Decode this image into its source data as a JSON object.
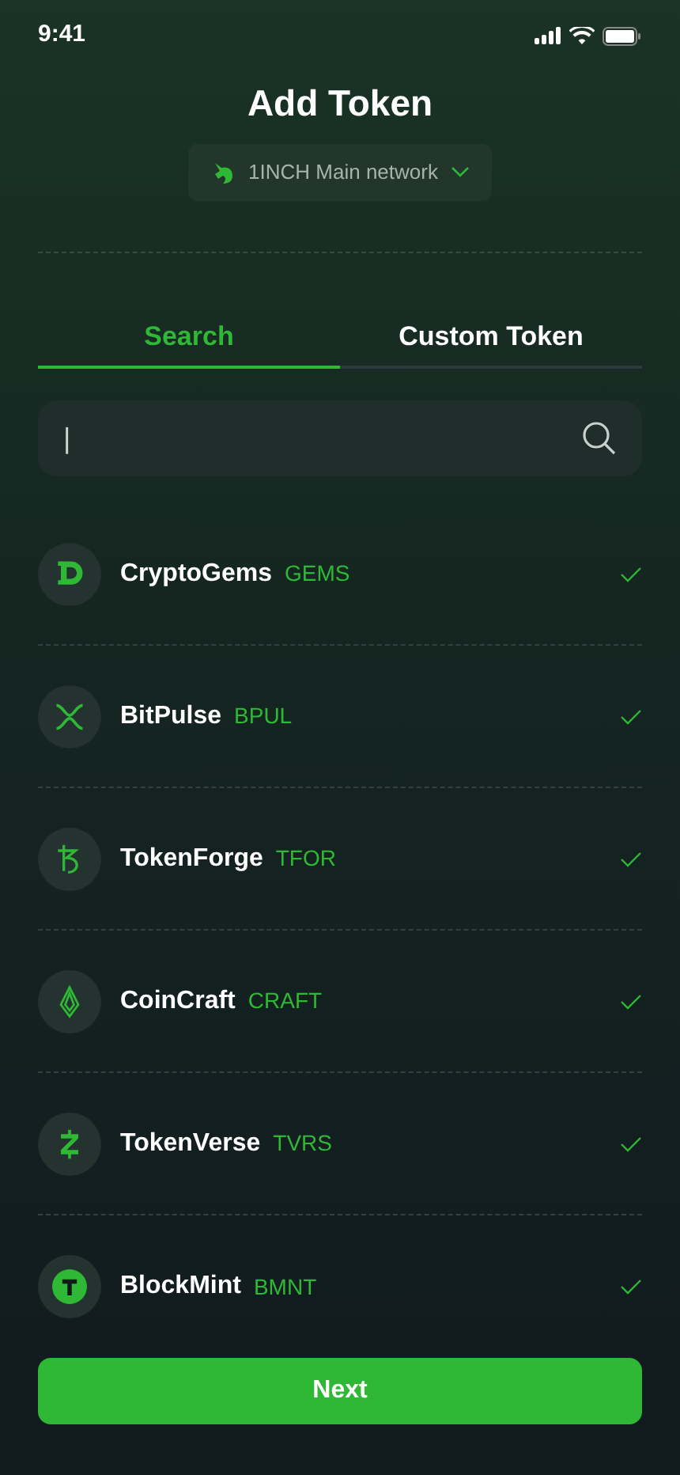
{
  "status_bar": {
    "time": "9:41"
  },
  "title": "Add Token",
  "network": {
    "label": "1INCH Main network"
  },
  "tabs": [
    {
      "label": "Search",
      "selected": true
    },
    {
      "label": "Custom Token",
      "selected": false
    }
  ],
  "search": {
    "value": "|"
  },
  "tokens": [
    {
      "name": "CryptoGems",
      "symbol": "GEMS",
      "checked": true
    },
    {
      "name": "BitPulse",
      "symbol": "BPUL",
      "checked": true
    },
    {
      "name": "TokenForge",
      "symbol": "TFOR",
      "checked": true
    },
    {
      "name": "CoinCraft",
      "symbol": "CRAFT",
      "checked": true
    },
    {
      "name": "TokenVerse",
      "symbol": "TVRS",
      "checked": true
    },
    {
      "name": "BlockMint",
      "symbol": "BMNT",
      "checked": true
    }
  ],
  "button": "Next"
}
